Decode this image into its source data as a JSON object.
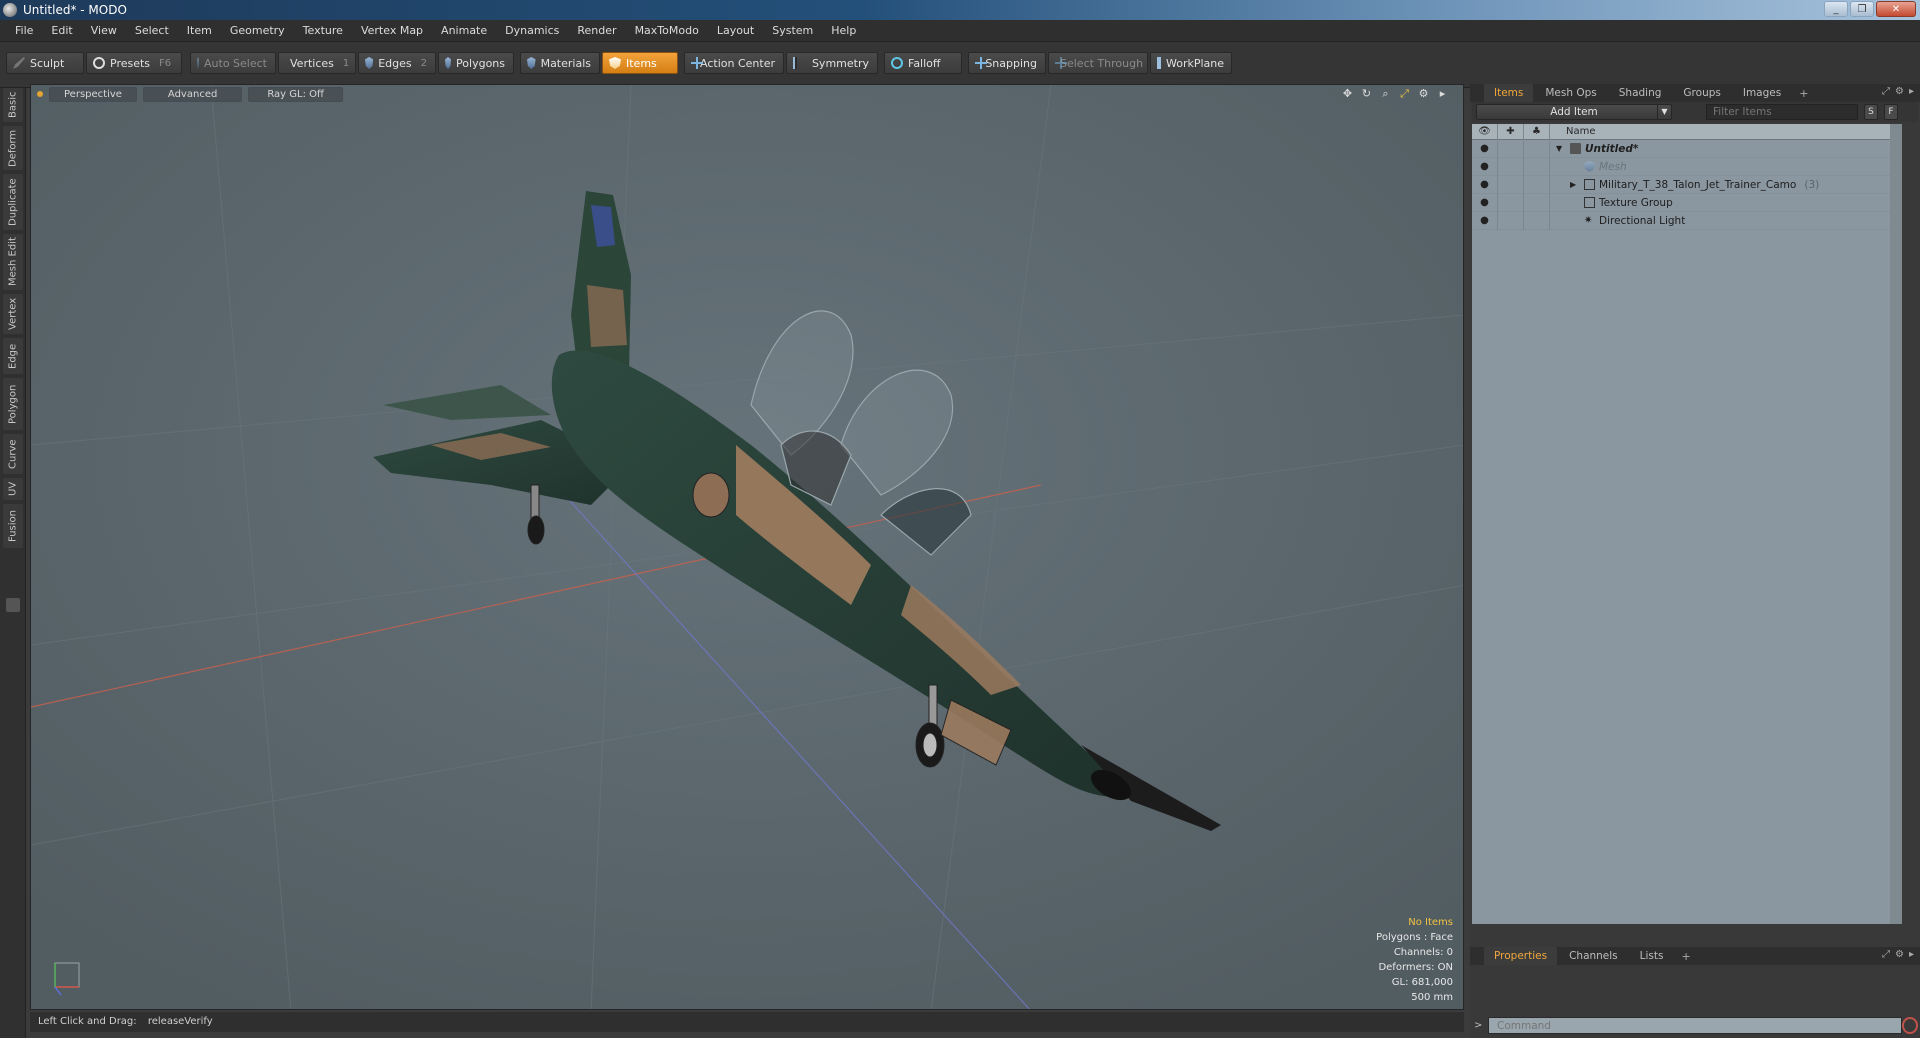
{
  "window": {
    "title": "Untitled* - MODO"
  },
  "menu": [
    "File",
    "Edit",
    "View",
    "Select",
    "Item",
    "Geometry",
    "Texture",
    "Vertex Map",
    "Animate",
    "Dynamics",
    "Render",
    "MaxToModo",
    "Layout",
    "System",
    "Help"
  ],
  "toolbar": {
    "sculpt": "Sculpt",
    "presets": "Presets",
    "presets_key": "F6",
    "auto_select": "Auto Select",
    "vertices": "Vertices",
    "vertices_key": "1",
    "edges": "Edges",
    "edges_key": "2",
    "polygons": "Polygons",
    "materials": "Materials",
    "items": "Items",
    "action_center": "Action Center",
    "symmetry": "Symmetry",
    "falloff": "Falloff",
    "snapping": "Snapping",
    "select_through": "Select Through",
    "workplane": "WorkPlane"
  },
  "left_tabs": [
    "Basic",
    "Deform",
    "Duplicate",
    "Mesh Edit",
    "Vertex",
    "Edge",
    "Polygon",
    "Curve",
    "UV",
    "Fusion"
  ],
  "viewport": {
    "perspective": "Perspective",
    "advanced": "Advanced",
    "raygl": "Ray GL: Off",
    "stats": {
      "no_items": "No Items",
      "polygons": "Polygons : Face",
      "channels": "Channels: 0",
      "deformers": "Deformers: ON",
      "gl": "GL: 681,000",
      "scale": "500 mm"
    }
  },
  "statusbar": {
    "hint": "Left Click and Drag:",
    "action": "releaseVerify"
  },
  "panel": {
    "tabs": [
      "Items",
      "Mesh Ops",
      "Shading",
      "Groups",
      "Images"
    ],
    "add_item": "Add Item",
    "filter_placeholder": "Filter Items",
    "btn_s": "S",
    "btn_f": "F",
    "name_col": "Name",
    "tree": [
      {
        "label": "Untitled*",
        "kind": "scene",
        "dim": false
      },
      {
        "label": "Mesh",
        "kind": "mesh",
        "dim": true
      },
      {
        "label": "Military_T_38_Talon_Jet_Trainer_Camo",
        "suffix": "(3)",
        "kind": "group",
        "dim": false
      },
      {
        "label": "Texture Group",
        "kind": "group",
        "dim": false
      },
      {
        "label": "Directional Light",
        "kind": "light",
        "dim": false
      }
    ],
    "bottom_tabs": [
      "Properties",
      "Channels",
      "Lists"
    ],
    "command_placeholder": "Command"
  },
  "colors": {
    "accent": "#f0a83a",
    "viewport_bg": "#5b676c",
    "camo_green": "#2f473f",
    "camo_tan": "#9b7a5e"
  }
}
